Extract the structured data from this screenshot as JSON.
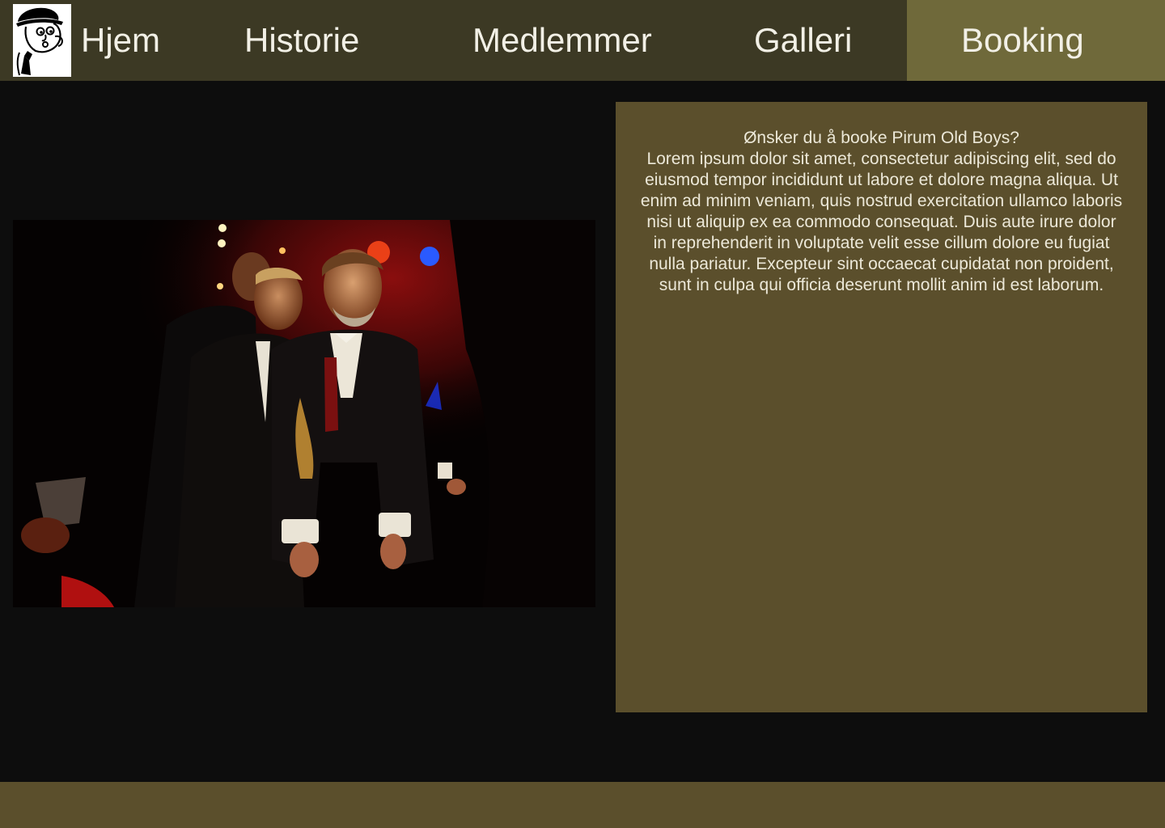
{
  "nav": {
    "logo_label": "Pirum Old Boys logo",
    "items": [
      {
        "label": "Hjem"
      },
      {
        "label": "Historie"
      },
      {
        "label": "Medlemmer"
      },
      {
        "label": "Galleri"
      },
      {
        "label": "Booking",
        "active": true
      }
    ]
  },
  "booking": {
    "heading": "Ønsker du å booke Pirum Old Boys?",
    "body": "Lorem ipsum dolor sit amet, consectetur adipiscing elit, sed do eiusmod tempor incididunt ut labore et dolore magna aliqua. Ut enim ad minim veniam, quis nostrud exercitation ullamco laboris nisi ut aliquip ex ea commodo consequat. Duis aute irure dolor in reprehenderit in voluptate velit esse cillum dolore eu fugiat nulla pariatur. Excepteur sint occaecat cupidatat non proident, sunt in culpa qui officia deserunt mollit anim id est laborum."
  },
  "colors": {
    "navbar": "#3c3924",
    "active_tab": "#6f693a",
    "panel": "#5b4f2c",
    "footer": "#5b4f2c",
    "background": "#0d0d0d",
    "text": "#f2f0e6"
  },
  "icons": {
    "logo": "caricature-logo-icon"
  }
}
